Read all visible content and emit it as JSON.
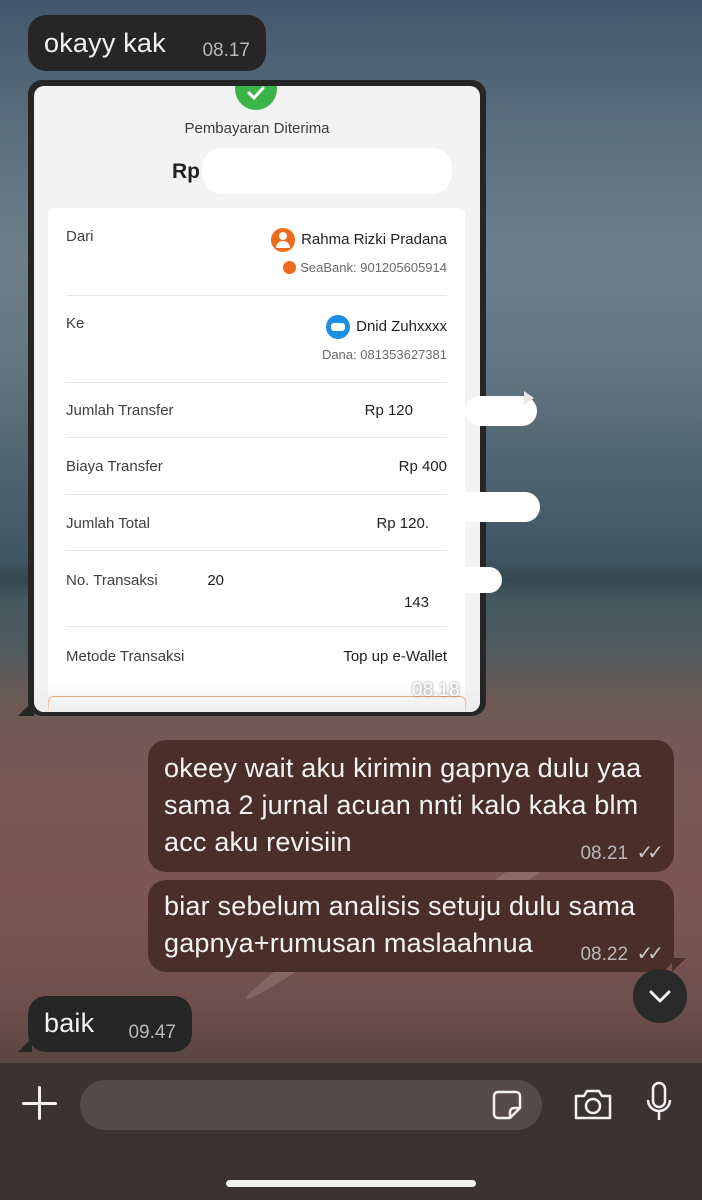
{
  "messages": [
    {
      "text": "okayy kak",
      "time": "08.17"
    },
    {
      "image_time": "08.18"
    },
    {
      "text": "okeey wait aku kirimin gapnya dulu yaa sama 2 jurnal acuan nnti kalo kaka blm acc aku revisiin",
      "time": "08.21"
    },
    {
      "text": "biar sebelum analisis setuju dulu sama gapnya+rumusan maslaahnua",
      "time": "08.22"
    },
    {
      "text": "baik",
      "time": "09.47"
    }
  ],
  "receipt": {
    "title": "Pembayaran Diterima",
    "amount": "Rp",
    "from_label": "Dari",
    "from_name": "Rahma Rizki Pradana",
    "from_account": "SeaBank: 901205605914",
    "to_label": "Ke",
    "to_name": "Dnid Zuhxxxx",
    "to_account": "Dana: 081353627381",
    "transfer_label": "Jumlah Transfer",
    "transfer_value": "Rp 120",
    "fee_label": "Biaya Transfer",
    "fee_value": "Rp 400",
    "total_label": "Jumlah Total",
    "total_value": "Rp 120.",
    "trx_label": "No. Transaksi",
    "trx_value_start": "20",
    "trx_value_end": "143",
    "method_label": "Metode Transaksi",
    "method_value": "Top up e-Wallet"
  },
  "icons": {
    "check": "check-icon",
    "scroll": "chevron-down-icon",
    "read": "double-check-icon"
  },
  "colors": {
    "outgoing_bubble": "#4a2f29",
    "incoming_bubble": "#262626",
    "success": "#3bb54a"
  }
}
